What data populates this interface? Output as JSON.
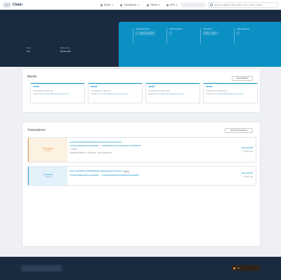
{
  "header": {
    "brand": "Chain",
    "nav": [
      {
        "label": "Blocks",
        "icon": "cube-icon"
      },
      {
        "label": "Transactions",
        "icon": "swap-icon"
      },
      {
        "label": "Tokens",
        "icon": "token-icon"
      },
      {
        "label": "APIs",
        "icon": "api-icon"
      }
    ],
    "search_placeholder": "Search by address / token symbol / name / tx hash / block #"
  },
  "hero": {
    "left_stats": [
      {
        "label": "Price",
        "value": "N/A"
      },
      {
        "label": "Market Cap",
        "value": "$0.00 USD"
      }
    ],
    "cards": [
      {
        "label": "Average block time",
        "value": "5 seconds"
      },
      {
        "label": "Total transactions",
        "value": "2"
      },
      {
        "label": "Total blocks",
        "value": "265,587"
      },
      {
        "label": "Wallet addresses",
        "value": "3"
      }
    ]
  },
  "blocks": {
    "title": "Blocks",
    "view_all": "View All Blocks",
    "cards": [
      {
        "number": "265587",
        "meta": "0 Transactions   1 minute ago",
        "validator_prefix": "Validated by",
        "validator": "0x89f9b9bff8a8b69e6ed6c9fd0f4CC4"
      },
      {
        "number": "265586",
        "meta": "0 Transactions   1 minute ago",
        "validator_prefix": "Validated by",
        "validator": "0x7f1be03c488ab2da2b7be4f4SNE9FC"
      },
      {
        "number": "265585",
        "meta": "0 Transactions   2 minutes ago",
        "validator_prefix": "Validated by",
        "validator": "0x89f9b9bff8a8b69e6ed6c9fd0f4CC4"
      },
      {
        "number": "265584",
        "meta": "0 Transactions   2 minutes ago",
        "validator_prefix": "Validated by",
        "validator": "0x7f1be03c488ab2da2b7be4f4SNE9FC"
      }
    ]
  },
  "transactions": {
    "title": "Transactions",
    "view_all": "View all Transactions",
    "rows": [
      {
        "status": "Token Minting",
        "status_sub": "Success",
        "hash": "0xe9f7fc9f96f4f46c9f9b53f89f5fa4c2dfbf2b5ba40b1fb44c8f1b2cf4ac4f",
        "from": "0x7f1be03c488ab2da2b7be4f4SNE9FC",
        "to": "0x3d3ba0b3f71fdbec5a9bfe0de18c01e79fc95fa7d5f",
        "token_prefix": "-- TOKEN",
        "amount": "0x00000000-000000 >> 0x7f1be03c...4a47",
        "amount_suffix": "LINKAGE.IO",
        "block": "Block #254389",
        "ago": "3 months ago"
      },
      {
        "status": "Transaction",
        "status_sub": "Success",
        "hash": "0xaa7fc1e2f8a53f47de45b4d8f9dd4d8ab1d9f9e8fe9d0dd7f5e1f2b27e1",
        "tag": "Register",
        "from": "0x7f1be03c488ab2da2b7be4f4SNE9FC",
        "to": "0x7d9ee09935d0b9d1f7c2f8f9d9fe0dc9f3a2b5b6f",
        "token_prefix": "",
        "amount": "",
        "amount_suffix": "",
        "block": "Block #163873",
        "ago": "3 months ago"
      }
    ]
  },
  "footer": {
    "fund_label": "Join"
  }
}
